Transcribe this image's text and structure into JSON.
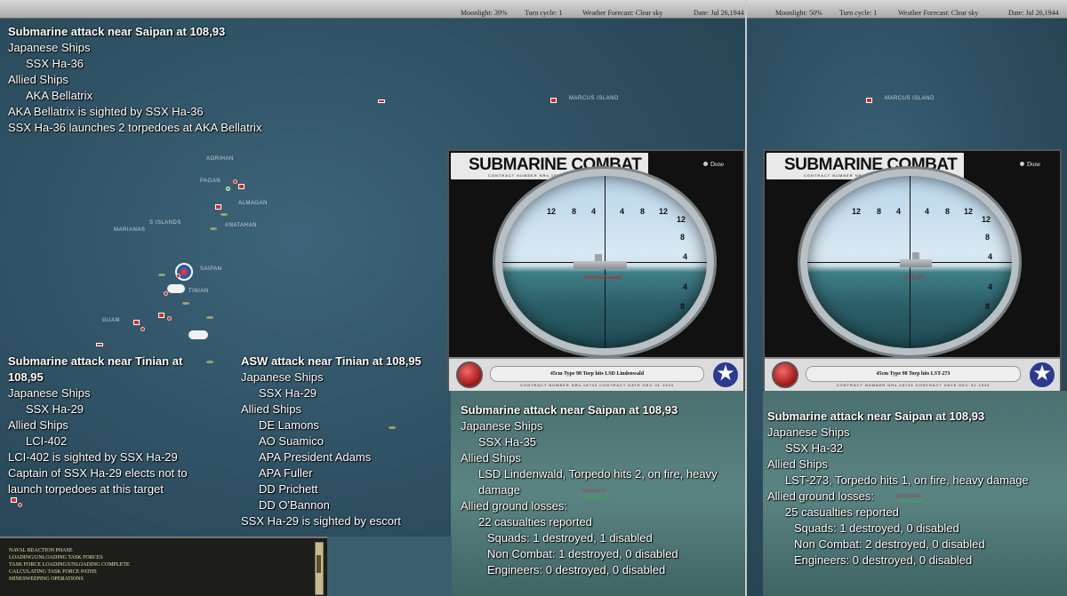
{
  "left_pane": {
    "topbar": {
      "moonlight": "Moonlight: 39%",
      "turn_cycle": "Turn cycle: 1",
      "weather": "Weather Forecast: Clear sky",
      "date": "Date: Jul 26,1944"
    },
    "map_labels": [
      "MARCUS ISLAND",
      "AGRIHAN",
      "PAGAN",
      "ALMAGAN",
      "ANATAHAN",
      "MARIANAS",
      "S ISLANDS",
      "SAIPAN",
      "TINIAN",
      "GUAM"
    ],
    "report1": {
      "lines": [
        {
          "text": "Submarine attack near Saipan  at 108,93",
          "style": "h"
        },
        {
          "text": "Japanese Ships",
          "style": ""
        },
        {
          "text": "SSX Ha-36",
          "style": "i1"
        },
        {
          "text": "Allied Ships",
          "style": ""
        },
        {
          "text": "AKA Bellatrix",
          "style": "i1"
        },
        {
          "text": "AKA Bellatrix is sighted by SSX Ha-36",
          "style": ""
        },
        {
          "text": "SSX Ha-36 launches 2 torpedoes  at AKA Bellatrix",
          "style": ""
        }
      ]
    },
    "report2": {
      "lines": [
        {
          "text": "Submarine attack near Tinian  at 108,95",
          "style": "h"
        },
        {
          "text": "Japanese Ships",
          "style": ""
        },
        {
          "text": "SSX Ha-29",
          "style": "i1"
        },
        {
          "text": "Allied Ships",
          "style": ""
        },
        {
          "text": "LCI-402",
          "style": "i1"
        },
        {
          "text": "LCI-402 is sighted by SSX Ha-29",
          "style": ""
        },
        {
          "text": "Captain of SSX Ha-29 elects not to launch torpedoes  at this target",
          "style": ""
        }
      ]
    },
    "report3": {
      "lines": [
        {
          "text": "ASW attack near Tinian  at 108,95",
          "style": "h"
        },
        {
          "text": "Japanese Ships",
          "style": ""
        },
        {
          "text": "SSX Ha-29",
          "style": "i1"
        },
        {
          "text": "Allied Ships",
          "style": ""
        },
        {
          "text": "DE Lamons",
          "style": "i1"
        },
        {
          "text": "AO Suamico",
          "style": "i1"
        },
        {
          "text": "APA President Adams",
          "style": "i1"
        },
        {
          "text": "APA Fuller",
          "style": "i1"
        },
        {
          "text": "DD Prichett",
          "style": "i1"
        },
        {
          "text": "DD O'Bannon",
          "style": "i1"
        },
        {
          "text": "SSX Ha-29 is sighted by escort",
          "style": ""
        }
      ]
    },
    "combat": {
      "title": "SUBMARINE COMBAT",
      "subtitle": "CONTRACT NUMBER  NRs-18743      CONTRACT DATE  DEC 31 1943",
      "done": "Done",
      "target_label": "LSD Lindenwald",
      "caption": "45cm Type 98 Torp hits LSD Lindenwald",
      "contract_bottom": "CONTRACT NUMBER  NRs-18743      CONTRACT DATE  DEC 31 1943",
      "scale_top": [
        "12",
        "8",
        "4",
        "4",
        "8",
        "12"
      ],
      "scale_side": [
        "12",
        "8",
        "4",
        "4",
        "8",
        "12"
      ]
    },
    "result": {
      "unit_tag": "SSX Ha-35",
      "lines": [
        {
          "text": "Submarine attack near Saipan  at 108,93",
          "style": "h"
        },
        {
          "text": "Japanese Ships",
          "style": ""
        },
        {
          "text": "SSX Ha-35",
          "style": "i1"
        },
        {
          "text": "Allied Ships",
          "style": ""
        },
        {
          "text": "LSD Lindenwald, Torpedo hits 2,  on fire,  heavy damage",
          "style": "i1"
        },
        {
          "text": "Allied ground losses:",
          "style": ""
        },
        {
          "text": "22 casualties reported",
          "style": "i1"
        },
        {
          "text": "Squads: 1 destroyed, 1 disabled",
          "style": "i2"
        },
        {
          "text": "Non Combat: 1 destroyed, 0 disabled",
          "style": "i2"
        },
        {
          "text": "Engineers: 0 destroyed, 0 disabled",
          "style": "i2"
        }
      ]
    },
    "log": [
      "NAVAL REACTION PHASE",
      "LOADING/UNLOADING TASK FORCES",
      "TASK FORCE LOADING/UNLOADING COMPLETE",
      "CALCULATING TASK FORCE PATHS",
      "MINESWEEPING OPERATIONS"
    ]
  },
  "right_pane": {
    "topbar": {
      "moonlight": "Moonlight: 50%",
      "turn_cycle": "Turn cycle: 1",
      "weather": "Weather Forecast: Clear sky",
      "date": "Date: Jul 26,1944"
    },
    "map_labels": [
      "MARCUS ISLAND"
    ],
    "combat": {
      "title": "SUBMARINE COMBAT",
      "subtitle": "CONTRACT NUMBER  NRs-18743      CONTRACT DATE  DEC 31 1943",
      "done": "Done",
      "target_label": "LST-273",
      "caption": "45cm Type 98 Torp hits LST-273",
      "contract_bottom": "CONTRACT NUMBER  NRs-18743      CONTRACT DATE  DEC 31 1943",
      "scale_top": [
        "12",
        "8",
        "4",
        "4",
        "8",
        "12"
      ],
      "scale_side": [
        "12",
        "8",
        "4",
        "4",
        "8",
        "12"
      ]
    },
    "result": {
      "unit_tag": "SSX Ha-32",
      "lines": [
        {
          "text": "Submarine attack near Saipan  at 108,93",
          "style": "h"
        },
        {
          "text": "Japanese Ships",
          "style": ""
        },
        {
          "text": "SSX Ha-32",
          "style": "i1"
        },
        {
          "text": "Allied Ships",
          "style": ""
        },
        {
          "text": "LST-273, Torpedo hits 1,  on fire,  heavy damage",
          "style": "i1"
        },
        {
          "text": "Allied ground losses:",
          "style": ""
        },
        {
          "text": "25 casualties reported",
          "style": "i1"
        },
        {
          "text": "Squads: 1 destroyed, 0 disabled",
          "style": "i2"
        },
        {
          "text": "Non Combat: 2 destroyed, 0 disabled",
          "style": "i2"
        },
        {
          "text": "Engineers: 0 destroyed, 0 disabled",
          "style": "i2"
        }
      ]
    }
  }
}
